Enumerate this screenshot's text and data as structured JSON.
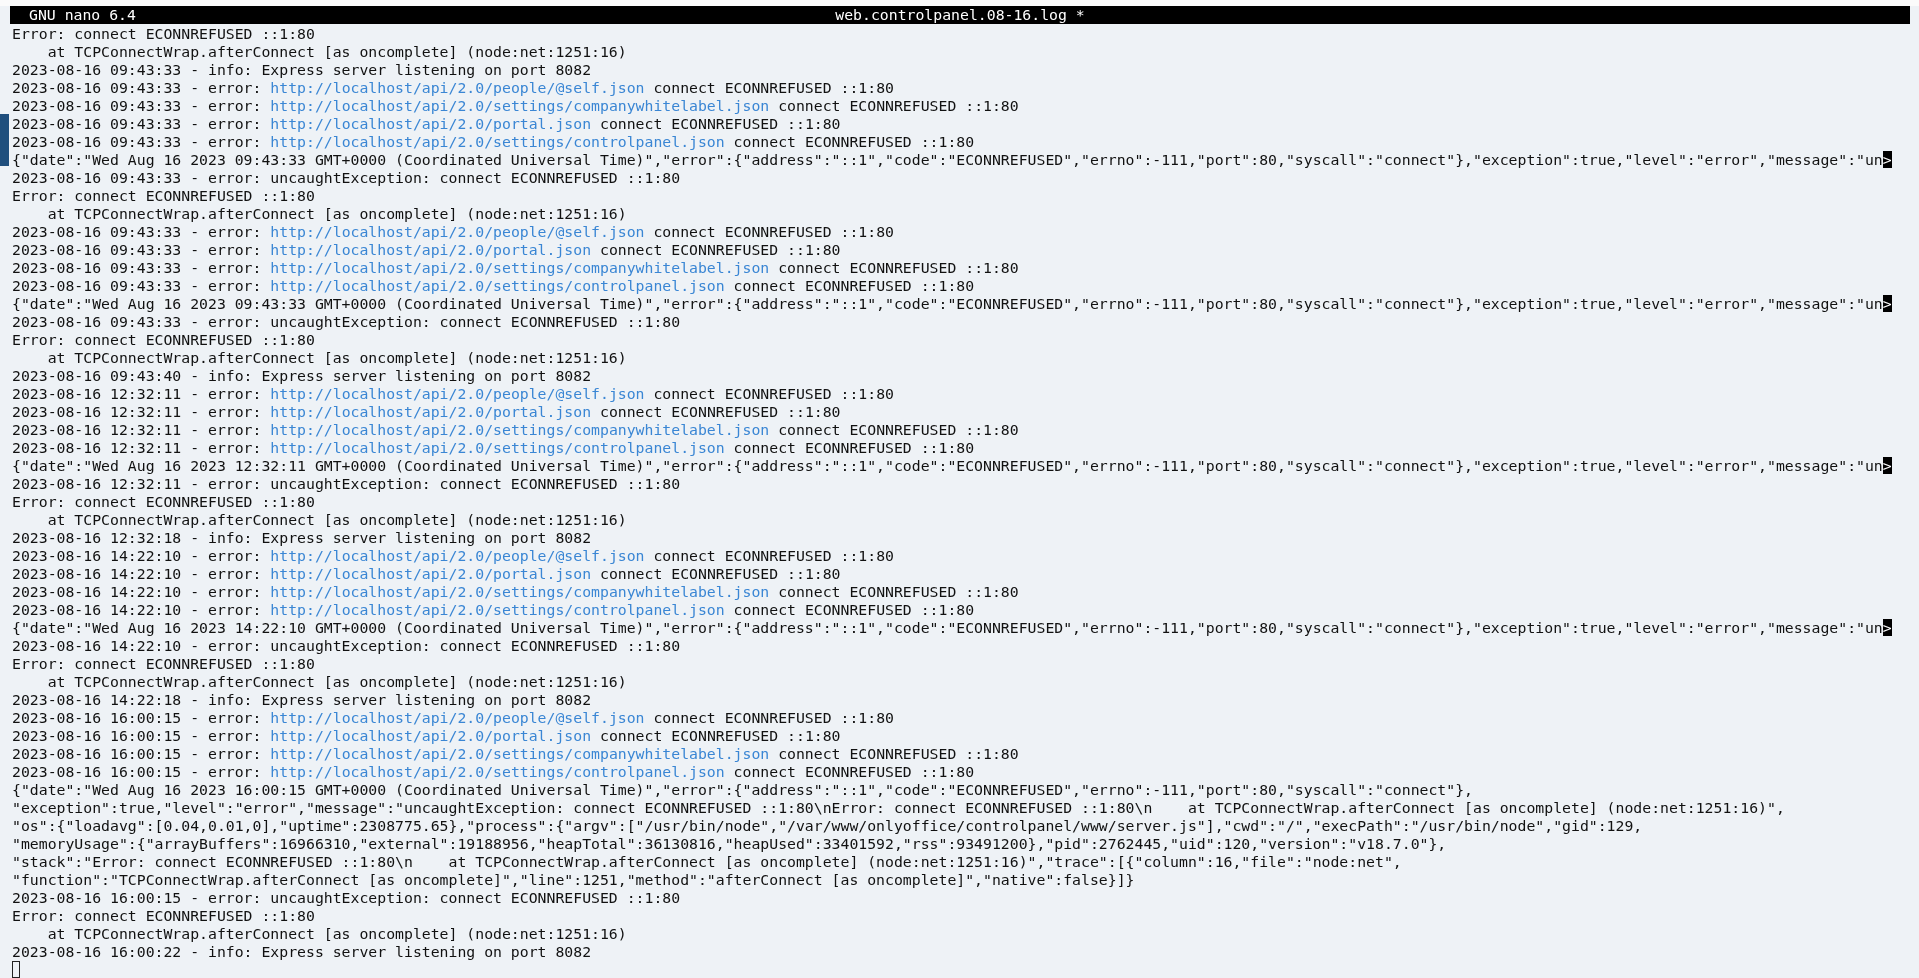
{
  "title_bar": {
    "app": "GNU nano 6.4",
    "file": "web.controlpanel.08-16.log *"
  },
  "lines": [
    {
      "kind": "text",
      "text": "Error: connect ECONNREFUSED ::1:80"
    },
    {
      "kind": "text",
      "text": "    at TCPConnectWrap.afterConnect [as oncomplete] (node:net:1251:16)"
    },
    {
      "kind": "text",
      "text": "2023-08-16 09:43:33 - info: Express server listening on port 8082"
    },
    {
      "kind": "link",
      "before": "2023-08-16 09:43:33 - error: ",
      "link": "http://localhost/api/2.0/people/@self.json",
      "after": " connect ECONNREFUSED ::1:80"
    },
    {
      "kind": "link",
      "before": "2023-08-16 09:43:33 - error: ",
      "link": "http://localhost/api/2.0/settings/companywhitelabel.json",
      "after": " connect ECONNREFUSED ::1:80"
    },
    {
      "kind": "link",
      "before": "2023-08-16 09:43:33 - error: ",
      "link": "http://localhost/api/2.0/portal.json",
      "after": " connect ECONNREFUSED ::1:80"
    },
    {
      "kind": "link",
      "before": "2023-08-16 09:43:33 - error: ",
      "link": "http://localhost/api/2.0/settings/controlpanel.json",
      "after": " connect ECONNREFUSED ::1:80"
    },
    {
      "kind": "clipped",
      "text": "{\"date\":\"Wed Aug 16 2023 09:43:33 GMT+0000 (Coordinated Universal Time)\",\"error\":{\"address\":\"::1\",\"code\":\"ECONNREFUSED\",\"errno\":-111,\"port\":80,\"syscall\":\"connect\"},\"exception\":true,\"level\":\"error\",\"message\":\"un",
      "marker": ">"
    },
    {
      "kind": "text",
      "text": "2023-08-16 09:43:33 - error: uncaughtException: connect ECONNREFUSED ::1:80"
    },
    {
      "kind": "text",
      "text": "Error: connect ECONNREFUSED ::1:80"
    },
    {
      "kind": "text",
      "text": "    at TCPConnectWrap.afterConnect [as oncomplete] (node:net:1251:16)"
    },
    {
      "kind": "link",
      "before": "2023-08-16 09:43:33 - error: ",
      "link": "http://localhost/api/2.0/people/@self.json",
      "after": " connect ECONNREFUSED ::1:80"
    },
    {
      "kind": "link",
      "before": "2023-08-16 09:43:33 - error: ",
      "link": "http://localhost/api/2.0/portal.json",
      "after": " connect ECONNREFUSED ::1:80"
    },
    {
      "kind": "link",
      "before": "2023-08-16 09:43:33 - error: ",
      "link": "http://localhost/api/2.0/settings/companywhitelabel.json",
      "after": " connect ECONNREFUSED ::1:80"
    },
    {
      "kind": "link",
      "before": "2023-08-16 09:43:33 - error: ",
      "link": "http://localhost/api/2.0/settings/controlpanel.json",
      "after": " connect ECONNREFUSED ::1:80"
    },
    {
      "kind": "clipped",
      "text": "{\"date\":\"Wed Aug 16 2023 09:43:33 GMT+0000 (Coordinated Universal Time)\",\"error\":{\"address\":\"::1\",\"code\":\"ECONNREFUSED\",\"errno\":-111,\"port\":80,\"syscall\":\"connect\"},\"exception\":true,\"level\":\"error\",\"message\":\"un",
      "marker": ">"
    },
    {
      "kind": "text",
      "text": "2023-08-16 09:43:33 - error: uncaughtException: connect ECONNREFUSED ::1:80"
    },
    {
      "kind": "text",
      "text": "Error: connect ECONNREFUSED ::1:80"
    },
    {
      "kind": "text",
      "text": "    at TCPConnectWrap.afterConnect [as oncomplete] (node:net:1251:16)"
    },
    {
      "kind": "text",
      "text": "2023-08-16 09:43:40 - info: Express server listening on port 8082"
    },
    {
      "kind": "link",
      "before": "2023-08-16 12:32:11 - error: ",
      "link": "http://localhost/api/2.0/people/@self.json",
      "after": " connect ECONNREFUSED ::1:80"
    },
    {
      "kind": "link",
      "before": "2023-08-16 12:32:11 - error: ",
      "link": "http://localhost/api/2.0/portal.json",
      "after": " connect ECONNREFUSED ::1:80"
    },
    {
      "kind": "link",
      "before": "2023-08-16 12:32:11 - error: ",
      "link": "http://localhost/api/2.0/settings/companywhitelabel.json",
      "after": " connect ECONNREFUSED ::1:80"
    },
    {
      "kind": "link",
      "before": "2023-08-16 12:32:11 - error: ",
      "link": "http://localhost/api/2.0/settings/controlpanel.json",
      "after": " connect ECONNREFUSED ::1:80"
    },
    {
      "kind": "clipped",
      "text": "{\"date\":\"Wed Aug 16 2023 12:32:11 GMT+0000 (Coordinated Universal Time)\",\"error\":{\"address\":\"::1\",\"code\":\"ECONNREFUSED\",\"errno\":-111,\"port\":80,\"syscall\":\"connect\"},\"exception\":true,\"level\":\"error\",\"message\":\"un",
      "marker": ">"
    },
    {
      "kind": "text",
      "text": "2023-08-16 12:32:11 - error: uncaughtException: connect ECONNREFUSED ::1:80"
    },
    {
      "kind": "text",
      "text": "Error: connect ECONNREFUSED ::1:80"
    },
    {
      "kind": "text",
      "text": "    at TCPConnectWrap.afterConnect [as oncomplete] (node:net:1251:16)"
    },
    {
      "kind": "text",
      "text": "2023-08-16 12:32:18 - info: Express server listening on port 8082"
    },
    {
      "kind": "link",
      "before": "2023-08-16 14:22:10 - error: ",
      "link": "http://localhost/api/2.0/people/@self.json",
      "after": " connect ECONNREFUSED ::1:80"
    },
    {
      "kind": "link",
      "before": "2023-08-16 14:22:10 - error: ",
      "link": "http://localhost/api/2.0/portal.json",
      "after": " connect ECONNREFUSED ::1:80"
    },
    {
      "kind": "link",
      "before": "2023-08-16 14:22:10 - error: ",
      "link": "http://localhost/api/2.0/settings/companywhitelabel.json",
      "after": " connect ECONNREFUSED ::1:80"
    },
    {
      "kind": "link",
      "before": "2023-08-16 14:22:10 - error: ",
      "link": "http://localhost/api/2.0/settings/controlpanel.json",
      "after": " connect ECONNREFUSED ::1:80"
    },
    {
      "kind": "clipped",
      "text": "{\"date\":\"Wed Aug 16 2023 14:22:10 GMT+0000 (Coordinated Universal Time)\",\"error\":{\"address\":\"::1\",\"code\":\"ECONNREFUSED\",\"errno\":-111,\"port\":80,\"syscall\":\"connect\"},\"exception\":true,\"level\":\"error\",\"message\":\"un",
      "marker": ">"
    },
    {
      "kind": "text",
      "text": "2023-08-16 14:22:10 - error: uncaughtException: connect ECONNREFUSED ::1:80"
    },
    {
      "kind": "text",
      "text": "Error: connect ECONNREFUSED ::1:80"
    },
    {
      "kind": "text",
      "text": "    at TCPConnectWrap.afterConnect [as oncomplete] (node:net:1251:16)"
    },
    {
      "kind": "text",
      "text": "2023-08-16 14:22:18 - info: Express server listening on port 8082"
    },
    {
      "kind": "link",
      "before": "2023-08-16 16:00:15 - error: ",
      "link": "http://localhost/api/2.0/people/@self.json",
      "after": " connect ECONNREFUSED ::1:80"
    },
    {
      "kind": "link",
      "before": "2023-08-16 16:00:15 - error: ",
      "link": "http://localhost/api/2.0/portal.json",
      "after": " connect ECONNREFUSED ::1:80"
    },
    {
      "kind": "link",
      "before": "2023-08-16 16:00:15 - error: ",
      "link": "http://localhost/api/2.0/settings/companywhitelabel.json",
      "after": " connect ECONNREFUSED ::1:80"
    },
    {
      "kind": "link",
      "before": "2023-08-16 16:00:15 - error: ",
      "link": "http://localhost/api/2.0/settings/controlpanel.json",
      "after": " connect ECONNREFUSED ::1:80"
    },
    {
      "kind": "text",
      "text": "{\"date\":\"Wed Aug 16 2023 16:00:15 GMT+0000 (Coordinated Universal Time)\",\"error\":{\"address\":\"::1\",\"code\":\"ECONNREFUSED\",\"errno\":-111,\"port\":80,\"syscall\":\"connect\"},"
    },
    {
      "kind": "text",
      "text": "\"exception\":true,\"level\":\"error\",\"message\":\"uncaughtException: connect ECONNREFUSED ::1:80\\nError: connect ECONNREFUSED ::1:80\\n    at TCPConnectWrap.afterConnect [as oncomplete] (node:net:1251:16)\","
    },
    {
      "kind": "text",
      "text": "\"os\":{\"loadavg\":[0.04,0.01,0],\"uptime\":2308775.65},\"process\":{\"argv\":[\"/usr/bin/node\",\"/var/www/onlyoffice/controlpanel/www/server.js\"],\"cwd\":\"/\",\"execPath\":\"/usr/bin/node\",\"gid\":129,"
    },
    {
      "kind": "text",
      "text": "\"memoryUsage\":{\"arrayBuffers\":16966310,\"external\":19188956,\"heapTotal\":36130816,\"heapUsed\":33401592,\"rss\":93491200},\"pid\":2762445,\"uid\":120,\"version\":\"v18.7.0\"},"
    },
    {
      "kind": "text",
      "text": "\"stack\":\"Error: connect ECONNREFUSED ::1:80\\n    at TCPConnectWrap.afterConnect [as oncomplete] (node:net:1251:16)\",\"trace\":[{\"column\":16,\"file\":\"node:net\","
    },
    {
      "kind": "text",
      "text": "\"function\":\"TCPConnectWrap.afterConnect [as oncomplete]\",\"line\":1251,\"method\":\"afterConnect [as oncomplete]\",\"native\":false}]}"
    },
    {
      "kind": "text",
      "text": "2023-08-16 16:00:15 - error: uncaughtException: connect ECONNREFUSED ::1:80"
    },
    {
      "kind": "text",
      "text": "Error: connect ECONNREFUSED ::1:80"
    },
    {
      "kind": "text",
      "text": "    at TCPConnectWrap.afterConnect [as oncomplete] (node:net:1251:16)"
    },
    {
      "kind": "text",
      "text": "2023-08-16 16:00:22 - info: Express server listening on port 8082"
    },
    {
      "kind": "cursor"
    }
  ]
}
